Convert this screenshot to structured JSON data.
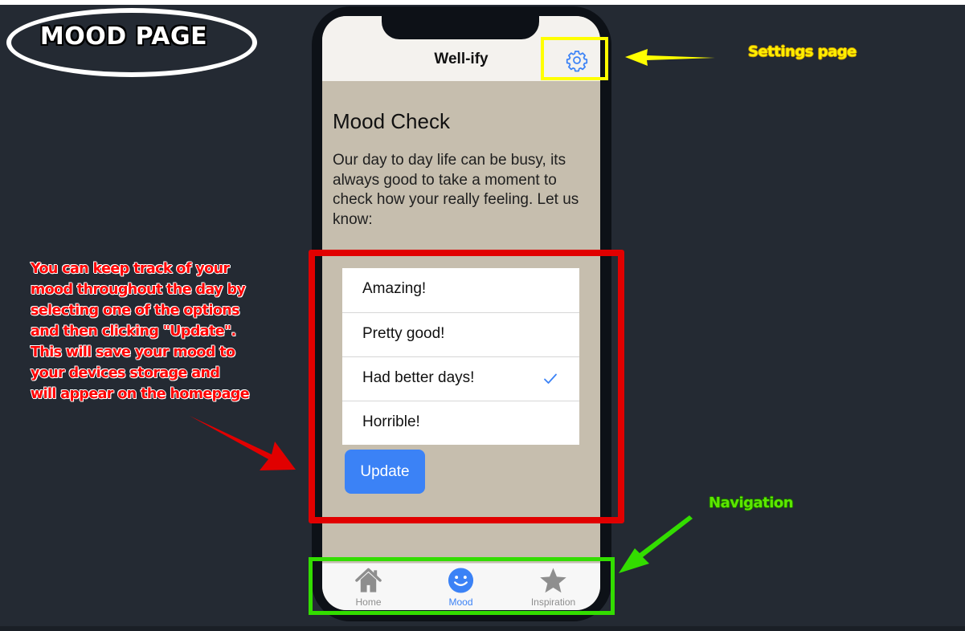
{
  "page_title": "MOOD PAGE",
  "app": {
    "title": "Well-ify",
    "settings_icon": "gear-icon"
  },
  "mood": {
    "heading": "Mood Check",
    "description": "Our day to day life can be busy, its always good to take a moment to check how your really feeling. Let us know:",
    "options": [
      {
        "label": "Amazing!",
        "selected": false
      },
      {
        "label": "Pretty good!",
        "selected": false
      },
      {
        "label": "Had better days!",
        "selected": true
      },
      {
        "label": "Horrible!",
        "selected": false
      }
    ],
    "update_label": "Update"
  },
  "tabs": [
    {
      "label": "Home",
      "icon": "home-icon",
      "active": false
    },
    {
      "label": "Mood",
      "icon": "smiley-icon",
      "active": true
    },
    {
      "label": "Inspiration",
      "icon": "star-icon",
      "active": false
    }
  ],
  "annotations": {
    "settings": "Settings page",
    "navigation": "Navigation",
    "mood_lines": [
      "You can keep track of your",
      "mood throughout the day by",
      "selecting one of the options",
      "and then clicking \"Update\".",
      "This will save your mood to",
      "your devices storage and",
      "will appear on the homepage"
    ]
  },
  "colors": {
    "accent": "#3b82f6",
    "screen_bg": "#c6beae",
    "settings_highlight": "#ffff00",
    "mood_highlight": "#e10000",
    "nav_highlight": "#33dd00"
  }
}
